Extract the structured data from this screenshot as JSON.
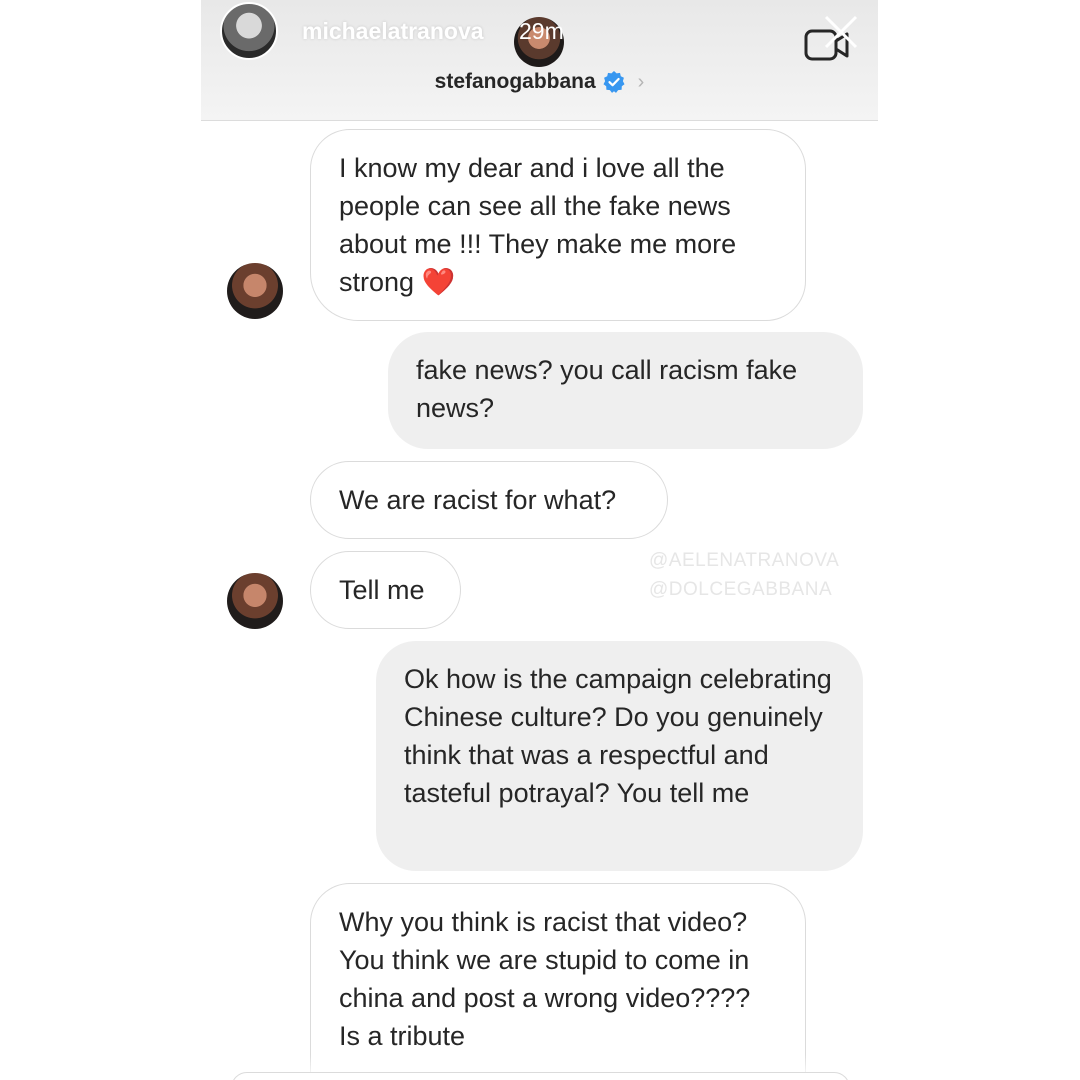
{
  "story": {
    "username": "michaelatranova",
    "time": "29m"
  },
  "conversation": {
    "name": "stefanogabbana",
    "verified": true,
    "accent_color": "#3897f0"
  },
  "messages": [
    {
      "sender": "them",
      "text": "I know my dear and i love all the people can see all the fake news about me !!! They make me more strong ❤️"
    },
    {
      "sender": "me",
      "text": "fake news? you call racism fake news?"
    },
    {
      "sender": "them",
      "text": "We are racist for what?"
    },
    {
      "sender": "them",
      "text": "Tell me"
    },
    {
      "sender": "me",
      "text": "Ok how is the campaign celebrating Chinese culture? Do you genuinely think that was a respectful and tasteful potrayal? You tell me"
    },
    {
      "sender": "them",
      "text": "Why you think is racist that video? You think we are stupid to come in china and post a wrong video???? Is a tribute"
    }
  ],
  "watermark": {
    "line1": "@AELENATRANOVA",
    "line2": "@DOLCEGABBANA"
  }
}
